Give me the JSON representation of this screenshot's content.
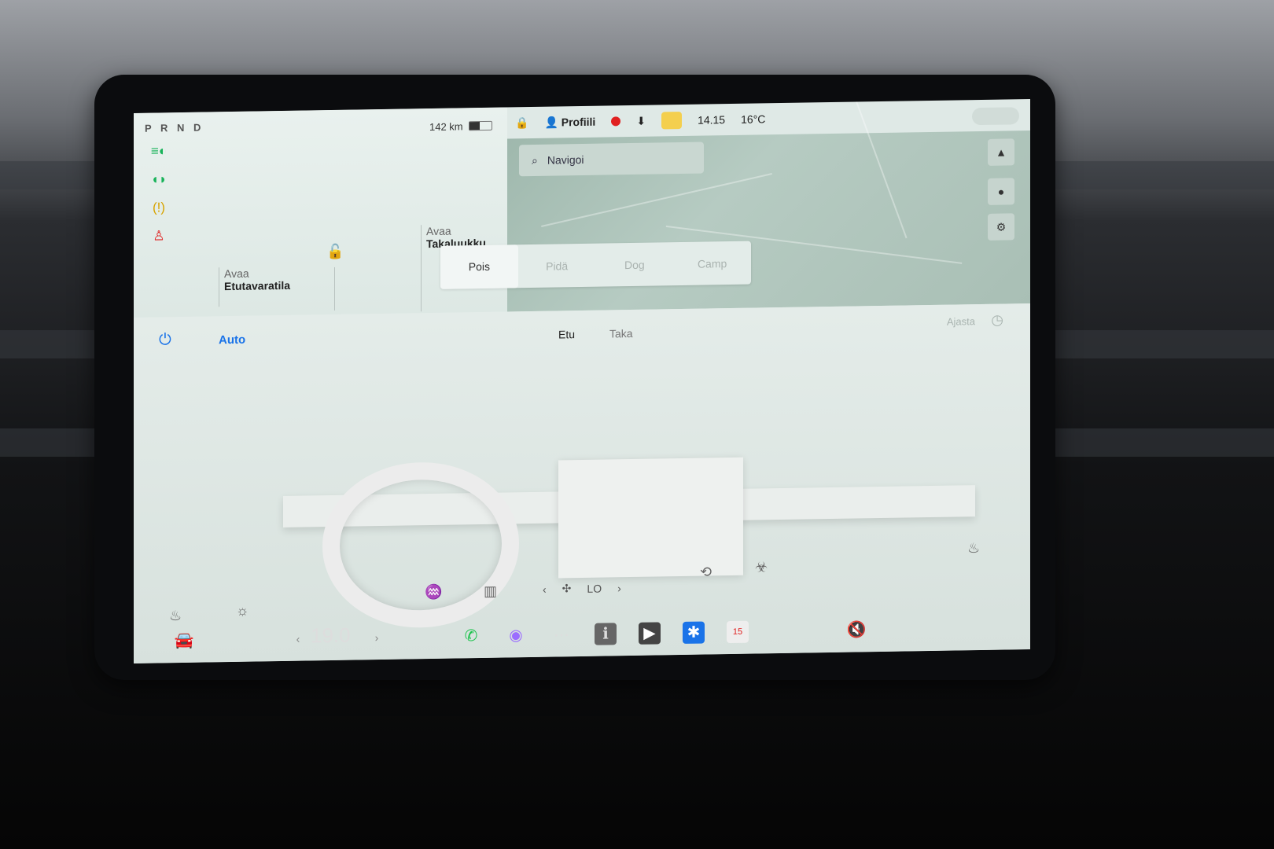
{
  "status": {
    "gear": "P R N D",
    "range": "142 km",
    "battery_level": 0.45,
    "telltales": [
      "headlight-icon",
      "parking-lights-icon",
      "tire-pressure-icon",
      "seatbelt-icon"
    ],
    "front_trunk": {
      "action": "Avaa",
      "target": "Etutavaratila"
    },
    "rear_trunk": {
      "action": "Avaa",
      "target": "Takaluukku"
    }
  },
  "topbar": {
    "profile": "Profiili",
    "time": "14.15",
    "temperature": "16°C"
  },
  "map": {
    "search_placeholder": "Navigoi"
  },
  "climate_modes": [
    "Pois",
    "Pidä",
    "Dog",
    "Camp"
  ],
  "climate_mode_active": "Pois",
  "climate": {
    "auto_label": "Auto",
    "zone_front": "Etu",
    "zone_rear": "Taka",
    "sync_label": "Ajasta",
    "fan_level": "LO"
  },
  "taskbar": {
    "set_temperature": "19.0",
    "calendar_date": "15"
  },
  "colors": {
    "accent_blue": "#1a73e8",
    "record_red": "#e02020",
    "phone_green": "#19c34a",
    "warning_yellow": "#d8a300"
  }
}
